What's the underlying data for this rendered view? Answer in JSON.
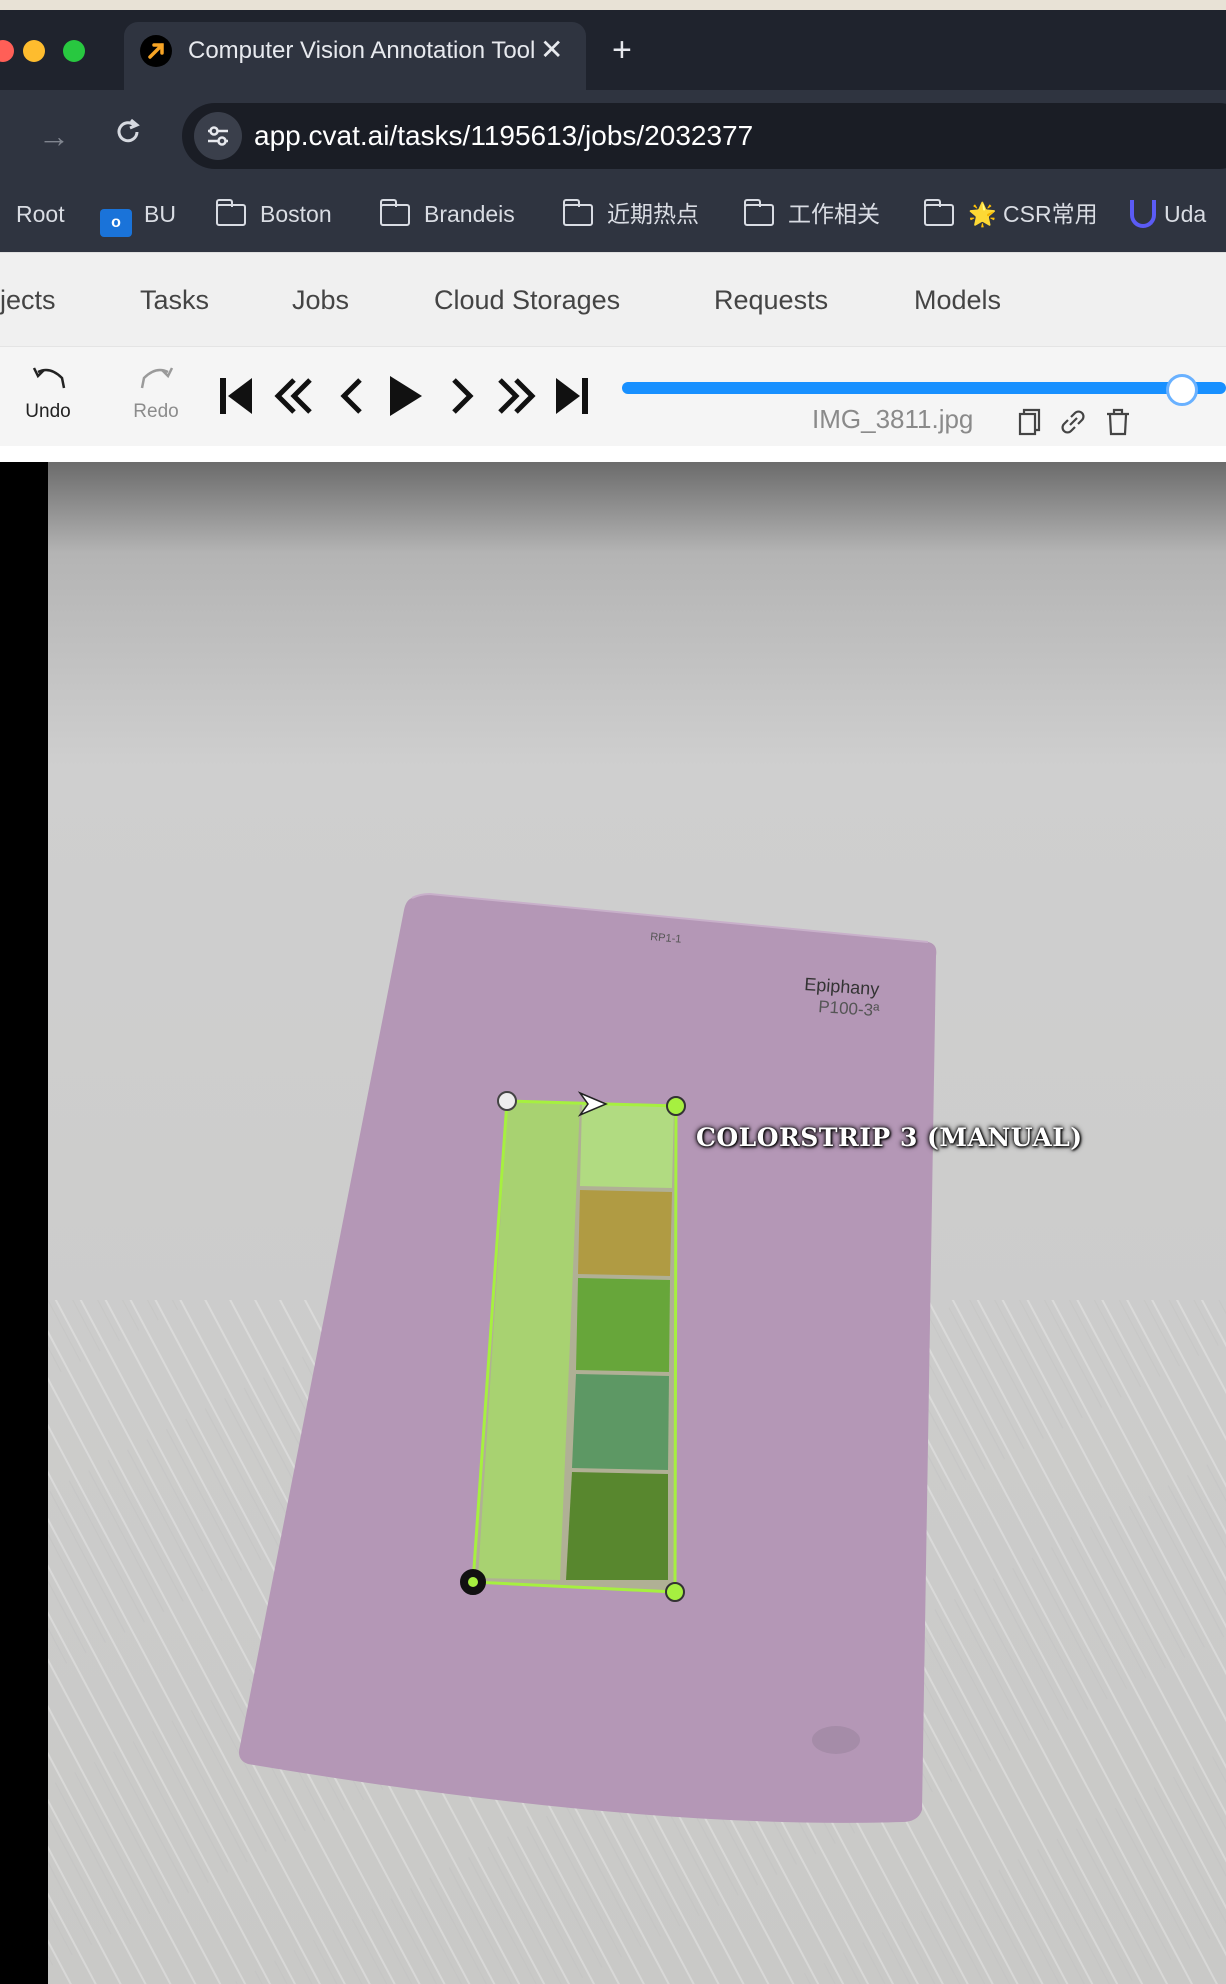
{
  "browser": {
    "tab_title": "Computer Vision Annotation Tool",
    "tab_close": "✕",
    "new_tab": "+",
    "url": "app.cvat.ai/tasks/1195613/jobs/2032377",
    "bookmarks": [
      {
        "label": "Root",
        "icon": "none"
      },
      {
        "label": "BU",
        "icon": "outlook-icon"
      },
      {
        "label": "Boston",
        "icon": "folder-icon"
      },
      {
        "label": "Brandeis",
        "icon": "folder-icon"
      },
      {
        "label": "近期热点",
        "icon": "folder-icon"
      },
      {
        "label": "工作相关",
        "icon": "folder-icon"
      },
      {
        "label": "🌟 CSR常用",
        "icon": "folder-icon"
      },
      {
        "label": "Uda",
        "icon": "magnet-icon"
      }
    ]
  },
  "nav": {
    "items": [
      "jects",
      "Tasks",
      "Jobs",
      "Cloud Storages",
      "Requests",
      "Models"
    ]
  },
  "player": {
    "undo_label": "Undo",
    "redo_label": "Redo",
    "filename": "IMG_3811.jpg",
    "frame_progress": 0.88
  },
  "annotation": {
    "label": "COLORSTRIP 3 (MANUAL)",
    "color": "#a6f040"
  },
  "photo": {
    "card_code": "RP1-1",
    "card_name": "Epiphany",
    "card_number": "P100-3ª"
  },
  "colors": {
    "accent": "#1890ff",
    "close_dot": "#ff5f57",
    "minimize_dot": "#febc2e",
    "maximize_dot": "#28c840",
    "card": "#b497b6",
    "swatches": [
      "#a6c27a",
      "#b47840",
      "#4e8636",
      "#3f7070",
      "#3a5a25"
    ]
  }
}
